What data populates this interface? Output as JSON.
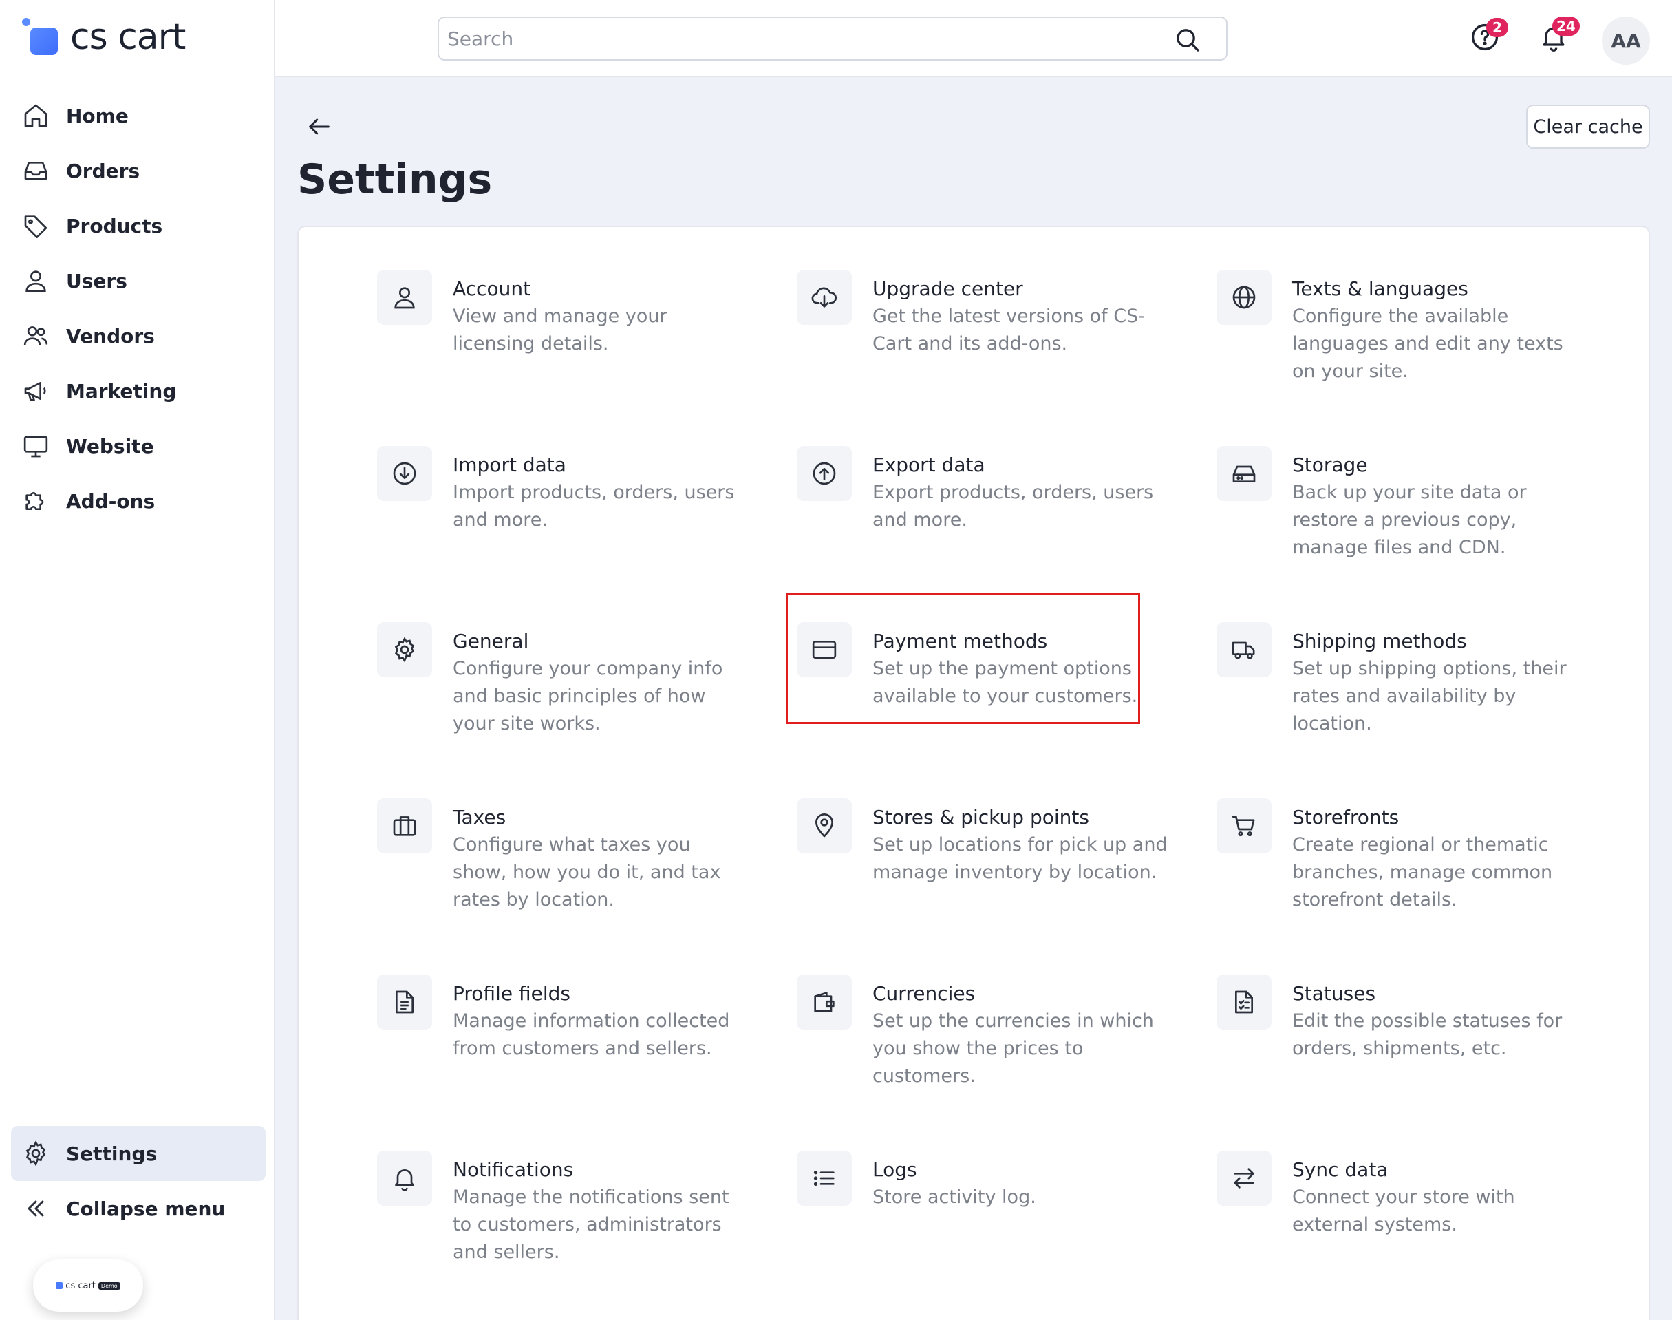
{
  "brand": {
    "name": "cs cart",
    "mini_name": "cs cart",
    "mini_tag": "Demo"
  },
  "sidebar": {
    "items": [
      {
        "key": "home",
        "label": "Home"
      },
      {
        "key": "orders",
        "label": "Orders"
      },
      {
        "key": "products",
        "label": "Products"
      },
      {
        "key": "users",
        "label": "Users"
      },
      {
        "key": "vendors",
        "label": "Vendors"
      },
      {
        "key": "marketing",
        "label": "Marketing"
      },
      {
        "key": "website",
        "label": "Website"
      },
      {
        "key": "addons",
        "label": "Add-ons"
      }
    ],
    "bottom": [
      {
        "key": "settings",
        "label": "Settings",
        "active": true
      },
      {
        "key": "collapse",
        "label": "Collapse menu"
      }
    ]
  },
  "topbar": {
    "search_placeholder": "Search",
    "help_badge": "2",
    "notifications_badge": "24",
    "avatar_initials": "AA"
  },
  "page": {
    "title": "Settings",
    "clear_cache_label": "Clear cache"
  },
  "settings": [
    {
      "title": "Account",
      "desc": "View and manage your licensing details.",
      "icon": "user-icon"
    },
    {
      "title": "Upgrade center",
      "desc": "Get the latest versions of CS-Cart and its add-ons.",
      "icon": "cloud-download-icon"
    },
    {
      "title": "Texts & languages",
      "desc": "Configure the available languages and edit any texts on your site.",
      "icon": "globe-icon"
    },
    {
      "title": "Import data",
      "desc": "Import products, orders, users and more.",
      "icon": "arrow-down-circle-icon"
    },
    {
      "title": "Export data",
      "desc": "Export products, orders, users and more.",
      "icon": "arrow-up-circle-icon"
    },
    {
      "title": "Storage",
      "desc": "Back up your site data or restore a previous copy, manage files and CDN.",
      "icon": "hard-drive-icon"
    },
    {
      "title": "General",
      "desc": "Configure your company info and basic principles of how your site works.",
      "icon": "gear-icon"
    },
    {
      "title": "Payment methods",
      "desc": "Set up the payment options available to your customers.",
      "icon": "credit-card-icon"
    },
    {
      "title": "Shipping methods",
      "desc": "Set up shipping options, their rates and availability by location.",
      "icon": "truck-icon"
    },
    {
      "title": "Taxes",
      "desc": "Configure what taxes you show, how you do it, and tax rates by location.",
      "icon": "briefcase-icon"
    },
    {
      "title": "Stores & pickup points",
      "desc": "Set up locations for pick up and manage inventory by location.",
      "icon": "map-pin-icon"
    },
    {
      "title": "Storefronts",
      "desc": "Create regional or thematic branches, manage common storefront details.",
      "icon": "cart-icon"
    },
    {
      "title": "Profile fields",
      "desc": "Manage information collected from customers and sellers.",
      "icon": "document-icon"
    },
    {
      "title": "Currencies",
      "desc": "Set up the currencies in which you show the prices to customers.",
      "icon": "wallet-icon"
    },
    {
      "title": "Statuses",
      "desc": "Edit the possible statuses for orders, shipments, etc.",
      "icon": "checklist-icon"
    },
    {
      "title": "Notifications",
      "desc": "Manage the notifications sent to customers, administrators and sellers.",
      "icon": "bell-icon"
    },
    {
      "title": "Logs",
      "desc": "Store activity log.",
      "icon": "list-icon"
    },
    {
      "title": "Sync data",
      "desc": "Connect your store with external systems.",
      "icon": "arrows-exchange-icon"
    }
  ],
  "colors": {
    "accent": "#3d6dfb",
    "badge": "#e0245e",
    "highlight": "#e01e1e"
  }
}
